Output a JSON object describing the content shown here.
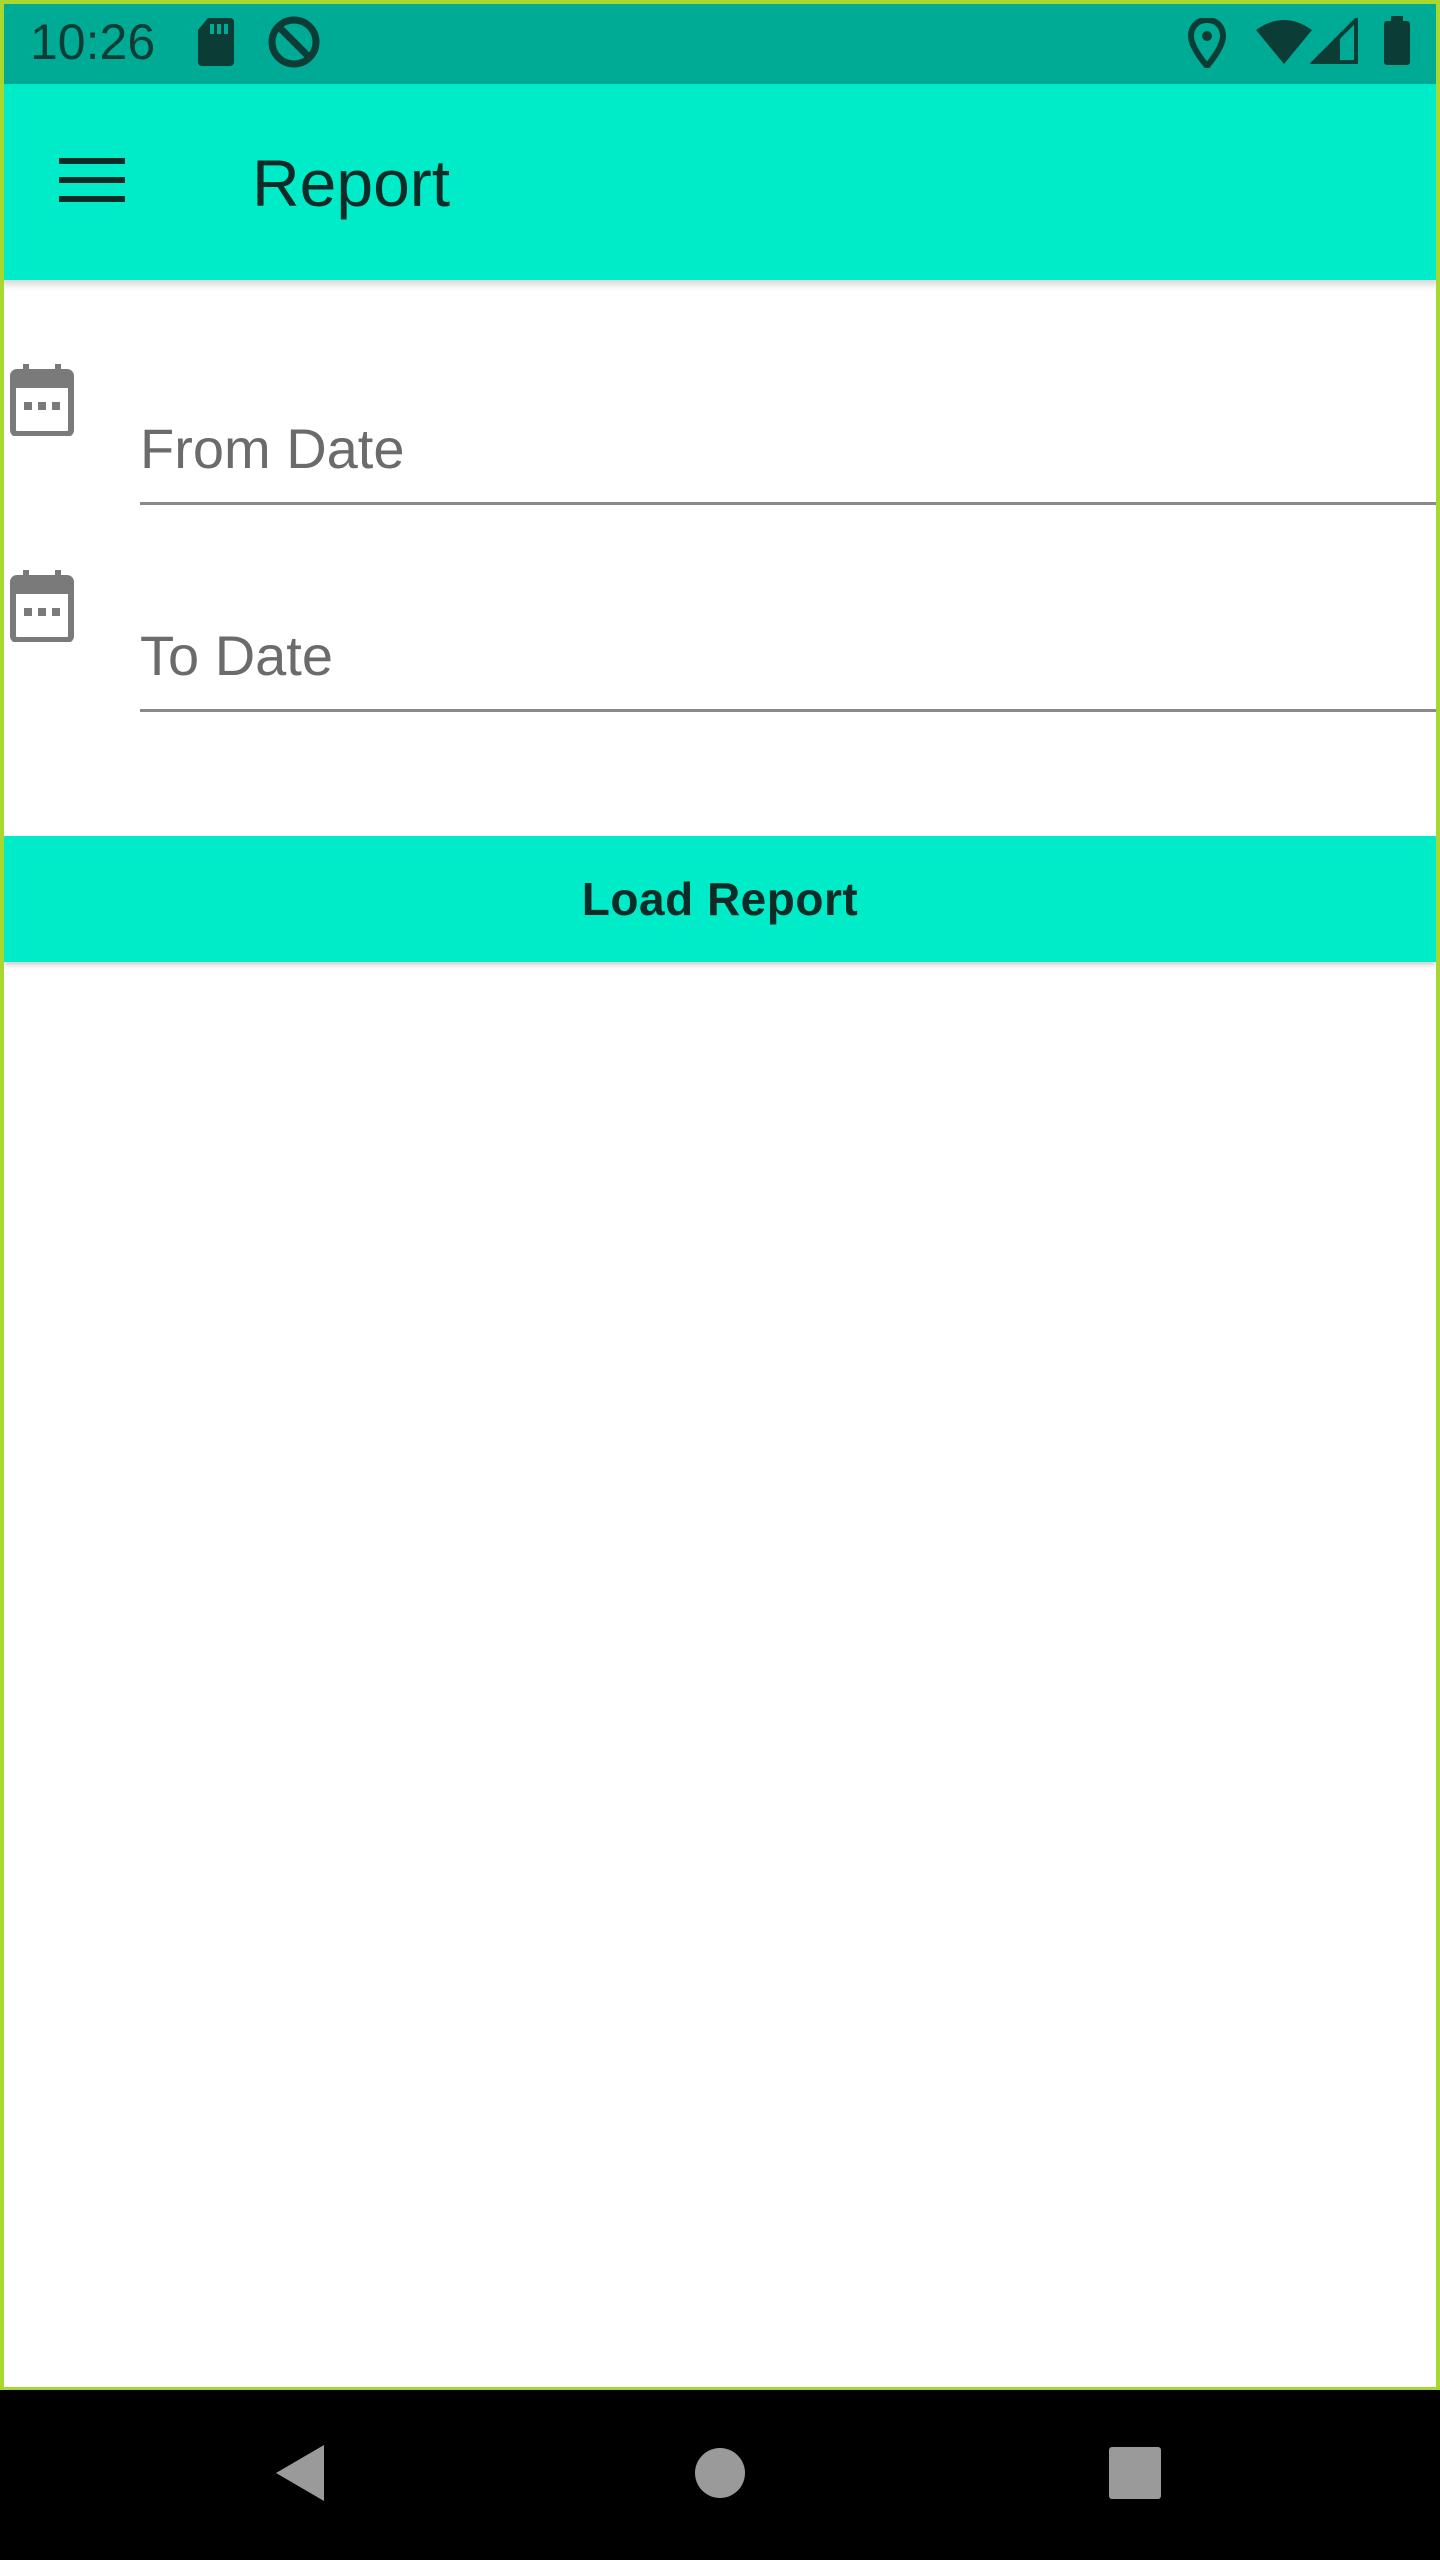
{
  "status_bar": {
    "time": "10:26",
    "left_icons": [
      "sd-card-icon",
      "data-saver-icon"
    ],
    "right_icons": [
      "location-icon",
      "wifi-icon",
      "signal-icon",
      "battery-icon"
    ],
    "color": "#00ab95"
  },
  "app_bar": {
    "title": "Report",
    "menu_icon": "hamburger-menu-icon",
    "color": "#00ebc8"
  },
  "form": {
    "from_date": {
      "placeholder": "From Date",
      "value": "",
      "icon": "calendar-icon"
    },
    "to_date": {
      "placeholder": "To Date",
      "value": "",
      "icon": "calendar-icon"
    },
    "load_button_label": "Load Report"
  },
  "nav_bar": {
    "buttons": [
      "back-icon",
      "home-icon",
      "recents-icon"
    ]
  }
}
